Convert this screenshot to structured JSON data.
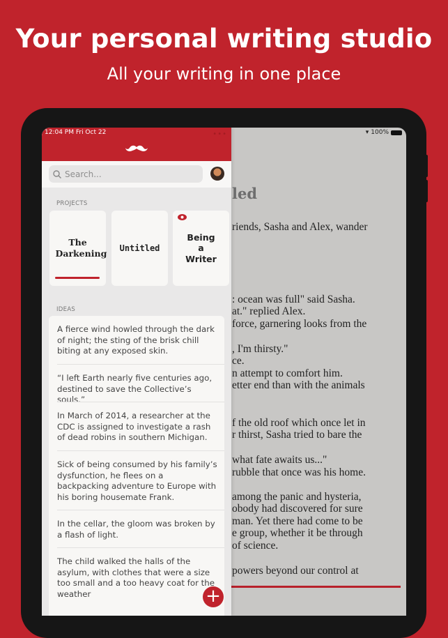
{
  "hero": {
    "title": "Your personal writing studio",
    "subtitle": "All your writing in one place"
  },
  "status": {
    "time": "12:04 PM   Fri Oct 22",
    "battery": "100%"
  },
  "colors": {
    "accent": "#c0232c",
    "editor_bg": "#c8c7c5"
  },
  "sidebar": {
    "logo": "mustache-icon",
    "search_placeholder": "Search...",
    "projects_label": "PROJECTS",
    "ideas_label": "IDEAS",
    "projects": [
      {
        "title": "The Darkening",
        "selected": true
      },
      {
        "title": "Untitled"
      },
      {
        "title": "Being a Writer",
        "icon": "eye-icon"
      }
    ],
    "ideas": [
      "A fierce wind howled through the dark of night; the sting of the brisk chill biting at any exposed skin.",
      "“I left Earth nearly five centuries ago, destined to save the Collective’s souls.”",
      "In March of 2014, a researcher at the CDC is assigned to investigate a rash of dead robins in southern Michigan.",
      "Sick of being consumed by his family’s dysfunction, he flees on a backpacking adventure to Europe with his boring housemate Frank.",
      "In the cellar, the gloom was broken by a flash of light.",
      "The child walked the halls of the asylum, with clothes that were a size too small and a too heavy coat for the weather"
    ],
    "add_label": "+"
  },
  "editor": {
    "title": "led",
    "lines": [
      "riends, Sasha and Alex, wander",
      "",
      "",
      ": ocean was full\" said Sasha.",
      "at.\" replied Alex.",
      "force, garnering looks from the",
      ", I'm thirsty.\"",
      "ce.",
      "n attempt to comfort him.",
      "etter end than with the animals",
      "f the old roof which once let in",
      "r thirst, Sasha tried to bare the",
      "what fate awaits us...\"",
      "rubble that once was his home.",
      "among the panic and hysteria,",
      "obody had discovered for sure",
      "man. Yet there had come to be",
      "e group, whether it be through",
      "of science.",
      " powers beyond our control at"
    ]
  }
}
